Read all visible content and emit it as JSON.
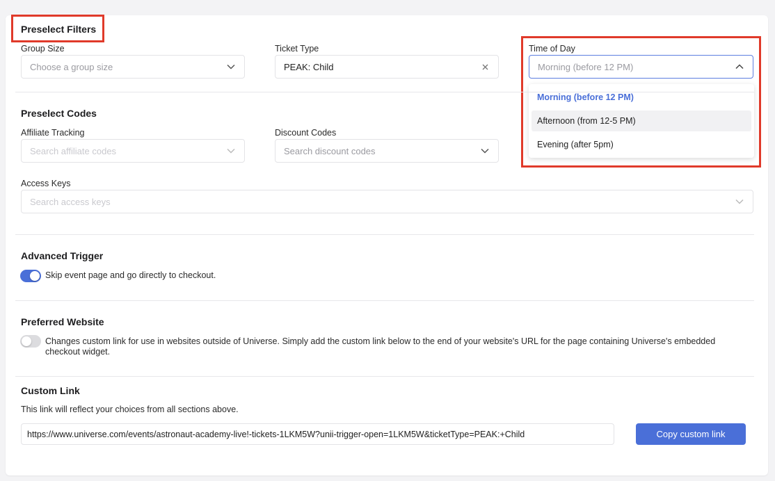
{
  "preselect_filters": {
    "title": "Preselect Filters",
    "group_size": {
      "label": "Group Size",
      "placeholder": "Choose a group size"
    },
    "ticket_type": {
      "label": "Ticket Type",
      "value": "PEAK: Child"
    },
    "time_of_day": {
      "label": "Time of Day",
      "placeholder": "Morning (before 12 PM)",
      "options": [
        "Morning (before 12 PM)",
        "Afternoon (from 12-5 PM)",
        "Evening (after 5pm)"
      ],
      "selected_index": 0,
      "hover_index": 1
    }
  },
  "preselect_codes": {
    "title": "Preselect Codes",
    "affiliate": {
      "label": "Affiliate Tracking",
      "placeholder": "Search affiliate codes"
    },
    "discount": {
      "label": "Discount Codes",
      "placeholder": "Search discount codes"
    },
    "access_keys": {
      "label": "Access Keys",
      "placeholder": "Search access keys"
    }
  },
  "advanced_trigger": {
    "title": "Advanced Trigger",
    "toggle_on": true,
    "text": "Skip event page and go directly to checkout."
  },
  "preferred_website": {
    "title": "Preferred Website",
    "toggle_on": false,
    "text": "Changes custom link for use in websites outside of Universe. Simply add the custom link below to the end of your website's URL for the page containing Universe's embedded checkout widget."
  },
  "custom_link": {
    "title": "Custom Link",
    "description": "This link will reflect your choices from all sections above.",
    "url": "https://www.universe.com/events/astronaut-academy-live!-tickets-1LKM5W?unii-trigger-open=1LKM5W&ticketType=PEAK:+Child",
    "copy_label": "Copy custom link"
  },
  "colors": {
    "accent": "#4a6fd8",
    "highlight_box": "#e03a2a"
  },
  "icons": [
    "chevron-down-icon",
    "chevron-up-icon",
    "clear-icon"
  ]
}
